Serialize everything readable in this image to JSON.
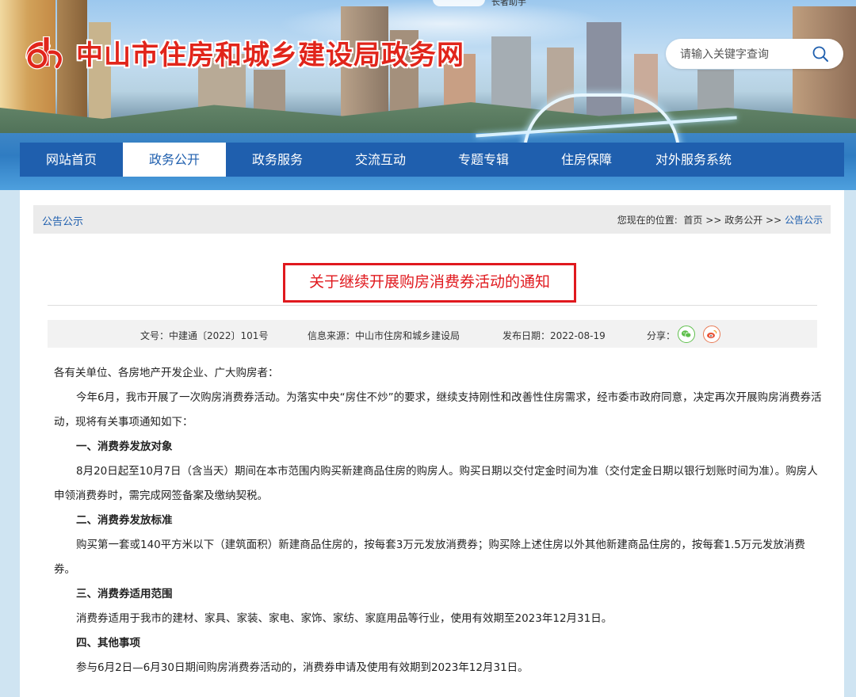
{
  "header": {
    "site_title": "中山市住房和城乡建设局政务网",
    "search_placeholder": "请输入关键字查询",
    "top_hint": "长者助手"
  },
  "nav": {
    "items": [
      {
        "label": "网站首页",
        "active": false
      },
      {
        "label": "政务公开",
        "active": true
      },
      {
        "label": "政务服务",
        "active": false
      },
      {
        "label": "交流互动",
        "active": false
      },
      {
        "label": "专题专辑",
        "active": false
      },
      {
        "label": "住房保障",
        "active": false
      },
      {
        "label": "对外服务系统",
        "active": false
      }
    ]
  },
  "breadcrumb": {
    "section": "公告公示",
    "prefix": "您现在的位置:",
    "home": "首页",
    "sep1": ">>",
    "level1": "政务公开",
    "sep2": ">>",
    "current": "公告公示"
  },
  "article": {
    "title": "关于继续开展购房消费券活动的通知",
    "meta": {
      "doc_no": "文号：中建通〔2022〕101号",
      "source": "信息来源：中山市住房和城乡建设局",
      "date": "发布日期：2022-08-19",
      "share_label": "分享："
    },
    "paragraphs": [
      "各有关单位、各房地产开发企业、广大购房者：",
      "今年6月，我市开展了一次购房消费券活动。为落实中央“房住不炒”的要求，继续支持刚性和改善性住房需求，经市委市政府同意，决定再次开展购房消费券活动，现将有关事项通知如下：",
      "一、消费券发放对象",
      "8月20日起至10月7日（含当天）期间在本市范围内购买新建商品住房的购房人。购买日期以交付定金时间为准（交付定金日期以银行划账时间为准）。购房人申领消费券时，需完成网签备案及缴纳契税。",
      "二、消费券发放标准",
      "购买第一套或140平方米以下（建筑面积）新建商品住房的，按每套3万元发放消费券；购买除上述住房以外其他新建商品住房的，按每套1.5万元发放消费券。",
      "三、消费券适用范围",
      "消费券适用于我市的建材、家具、家装、家电、家饰、家纺、家庭用品等行业，使用有效期至2023年12月31日。",
      "四、其他事项",
      "参与6月2日—6月30日期间购房消费券活动的，消费券申请及使用有效期到2023年12月31日。"
    ]
  },
  "colors": {
    "brand_red": "#e1251b",
    "nav_blue": "#1f5fae",
    "link_blue": "#1f5fae"
  }
}
